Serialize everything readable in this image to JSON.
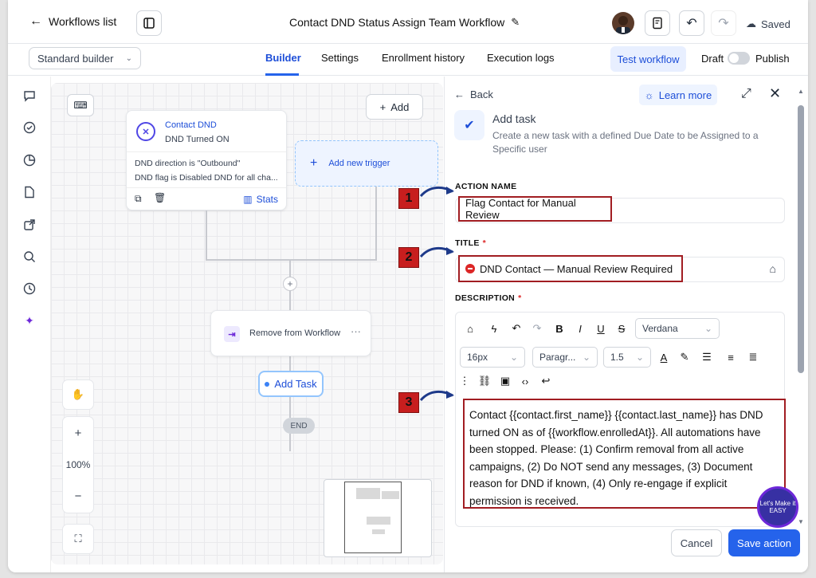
{
  "header": {
    "back_label": "Workflows list",
    "workflow_title": "Contact DND Status Assign Team Workflow",
    "saved_label": "Saved"
  },
  "subbar": {
    "builder_mode": "Standard builder",
    "tabs": [
      "Builder",
      "Settings",
      "Enrollment history",
      "Execution logs"
    ],
    "test_label": "Test workflow",
    "draft_label": "Draft",
    "publish_label": "Publish"
  },
  "canvas": {
    "add_label": "Add",
    "trigger": {
      "title": "Contact DND",
      "subtitle": "DND Turned ON",
      "filter1": "DND direction is \"Outbound\"",
      "filter2": "DND flag is Disabled DND for all cha...",
      "stats_label": "Stats"
    },
    "new_trigger_label": "Add new trigger",
    "action_label": "Remove from Workflow",
    "add_task_label": "Add Task",
    "end_label": "END",
    "zoom_level": "100%"
  },
  "panel": {
    "back_label": "Back",
    "learn_more": "Learn more",
    "title": "Add task",
    "description": "Create a new task with a defined Due Date to be Assigned to a Specific user",
    "action_name_label": "ACTION NAME",
    "action_name_value": "Flag Contact for Manual Review",
    "title_label": "TITLE",
    "title_value": "DND Contact — Manual Review Required",
    "description_label": "DESCRIPTION",
    "font_family": "Verdana",
    "font_size": "16px",
    "paragraph": "Paragr...",
    "line_height": "1.5",
    "body_text": "Contact {{contact.first_name}} {{contact.last_name}} has DND turned ON as of {{workflow.enrolledAt}}. All automations have been stopped. Please: (1) Confirm removal from all active campaigns, (2) Do NOT send any messages, (3) Document reason for DND if known, (4) Only re-engage if explicit permission is received.",
    "cancel_label": "Cancel",
    "save_label": "Save action"
  },
  "annotations": [
    "1",
    "2",
    "3"
  ],
  "watermark": "Let's Make it EASY",
  "colors": {
    "accent": "#2563eb",
    "highlight": "#a11d22",
    "badge": "#c71e1e"
  }
}
